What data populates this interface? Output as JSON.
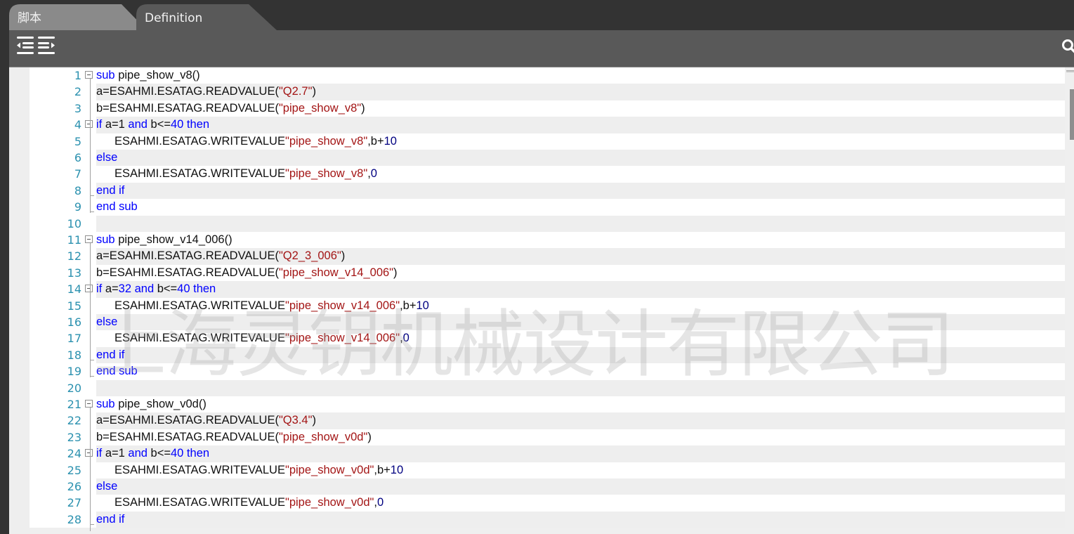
{
  "tabs": [
    {
      "label": "脚本",
      "active": false
    },
    {
      "label": "Definition",
      "active": true
    }
  ],
  "toolbar": {
    "indent_icon": "indent-outdent-icon",
    "search_icon": "search-icon"
  },
  "colors": {
    "keyword": "#0000ff",
    "string": "#a31515",
    "number": "#000080",
    "line_number": "#2b91af"
  },
  "watermark": "上海灵钥机械设计有限公司",
  "editor": {
    "lines": [
      {
        "n": "1",
        "fold": true,
        "indent": 0,
        "tokens": [
          [
            "kw",
            "sub"
          ],
          [
            "t",
            " pipe_show_v8()"
          ]
        ]
      },
      {
        "n": "2",
        "indent": 0,
        "tokens": [
          [
            "t",
            "a=ESAHMI.ESATAG.READVALUE("
          ],
          [
            "str",
            "\"Q2.7\""
          ],
          [
            "t",
            ")"
          ]
        ]
      },
      {
        "n": "3",
        "indent": 0,
        "tokens": [
          [
            "t",
            "b=ESAHMI.ESATAG.READVALUE("
          ],
          [
            "str",
            "\"pipe_show_v8\""
          ],
          [
            "t",
            ")"
          ]
        ]
      },
      {
        "n": "4",
        "fold": true,
        "indent": 0,
        "tokens": [
          [
            "kw",
            "if"
          ],
          [
            "t",
            " a=1 "
          ],
          [
            "kw",
            "and"
          ],
          [
            "t",
            " b<="
          ],
          [
            "kw",
            "40 then"
          ]
        ]
      },
      {
        "n": "5",
        "indent": 1,
        "tokens": [
          [
            "t",
            "ESAHMI.ESATAG.WRITEVALUE"
          ],
          [
            "str",
            "\"pipe_show_v8\""
          ],
          [
            "t",
            ",b+"
          ],
          [
            "num",
            "10"
          ]
        ]
      },
      {
        "n": "6",
        "indent": 0,
        "tokens": [
          [
            "kw",
            "else"
          ]
        ]
      },
      {
        "n": "7",
        "indent": 1,
        "tokens": [
          [
            "t",
            "ESAHMI.ESATAG.WRITEVALUE"
          ],
          [
            "str",
            "\"pipe_show_v8\""
          ],
          [
            "t",
            ","
          ],
          [
            "num",
            "0"
          ]
        ]
      },
      {
        "n": "8",
        "indent": 0,
        "tokens": [
          [
            "kw",
            "end if"
          ]
        ]
      },
      {
        "n": "9",
        "indent": 0,
        "tokens": [
          [
            "kw",
            "end sub"
          ]
        ]
      },
      {
        "n": "10",
        "indent": 0,
        "tokens": []
      },
      {
        "n": "11",
        "fold": true,
        "indent": 0,
        "tokens": [
          [
            "kw",
            "sub"
          ],
          [
            "t",
            " pipe_show_v14_006()"
          ]
        ]
      },
      {
        "n": "12",
        "indent": 0,
        "tokens": [
          [
            "t",
            "a=ESAHMI.ESATAG.READVALUE("
          ],
          [
            "str",
            "\"Q2_3_006\""
          ],
          [
            "t",
            ")"
          ]
        ]
      },
      {
        "n": "13",
        "indent": 0,
        "tokens": [
          [
            "t",
            "b=ESAHMI.ESATAG.READVALUE("
          ],
          [
            "str",
            "\"pipe_show_v14_006\""
          ],
          [
            "t",
            ")"
          ]
        ]
      },
      {
        "n": "14",
        "fold": true,
        "indent": 0,
        "tokens": [
          [
            "kw",
            "if"
          ],
          [
            "t",
            " a="
          ],
          [
            "kw",
            "32 and"
          ],
          [
            "t",
            " b<="
          ],
          [
            "kw",
            "40 then"
          ]
        ]
      },
      {
        "n": "15",
        "indent": 1,
        "tokens": [
          [
            "t",
            "ESAHMI.ESATAG.WRITEVALUE"
          ],
          [
            "str",
            "\"pipe_show_v14_006\""
          ],
          [
            "t",
            ",b+"
          ],
          [
            "num",
            "10"
          ]
        ]
      },
      {
        "n": "16",
        "indent": 0,
        "tokens": [
          [
            "kw",
            "else"
          ]
        ]
      },
      {
        "n": "17",
        "indent": 1,
        "tokens": [
          [
            "t",
            "ESAHMI.ESATAG.WRITEVALUE"
          ],
          [
            "str",
            "\"pipe_show_v14_006\""
          ],
          [
            "t",
            ","
          ],
          [
            "num",
            "0"
          ]
        ]
      },
      {
        "n": "18",
        "indent": 0,
        "tokens": [
          [
            "kw",
            "end if"
          ]
        ]
      },
      {
        "n": "19",
        "indent": 0,
        "tokens": [
          [
            "kw",
            "end sub"
          ]
        ]
      },
      {
        "n": "20",
        "indent": 0,
        "tokens": []
      },
      {
        "n": "21",
        "fold": true,
        "indent": 0,
        "tokens": [
          [
            "kw",
            "sub"
          ],
          [
            "t",
            " pipe_show_v0d()"
          ]
        ]
      },
      {
        "n": "22",
        "indent": 0,
        "tokens": [
          [
            "t",
            "a=ESAHMI.ESATAG.READVALUE("
          ],
          [
            "str",
            "\"Q3.4\""
          ],
          [
            "t",
            ")"
          ]
        ]
      },
      {
        "n": "23",
        "indent": 0,
        "tokens": [
          [
            "t",
            "b=ESAHMI.ESATAG.READVALUE("
          ],
          [
            "str",
            "\"pipe_show_v0d\""
          ],
          [
            "t",
            ")"
          ]
        ]
      },
      {
        "n": "24",
        "fold": true,
        "indent": 0,
        "tokens": [
          [
            "kw",
            "if"
          ],
          [
            "t",
            " a=1 "
          ],
          [
            "kw",
            "and"
          ],
          [
            "t",
            " b<="
          ],
          [
            "kw",
            "40 then"
          ]
        ]
      },
      {
        "n": "25",
        "indent": 1,
        "tokens": [
          [
            "t",
            "ESAHMI.ESATAG.WRITEVALUE"
          ],
          [
            "str",
            "\"pipe_show_v0d\""
          ],
          [
            "t",
            ",b+"
          ],
          [
            "num",
            "10"
          ]
        ]
      },
      {
        "n": "26",
        "indent": 0,
        "tokens": [
          [
            "kw",
            "else"
          ]
        ]
      },
      {
        "n": "27",
        "indent": 1,
        "tokens": [
          [
            "t",
            "ESAHMI.ESATAG.WRITEVALUE"
          ],
          [
            "str",
            "\"pipe_show_v0d\""
          ],
          [
            "t",
            ","
          ],
          [
            "num",
            "0"
          ]
        ]
      },
      {
        "n": "28",
        "indent": 0,
        "tokens": [
          [
            "kw",
            "end if"
          ]
        ]
      }
    ]
  }
}
